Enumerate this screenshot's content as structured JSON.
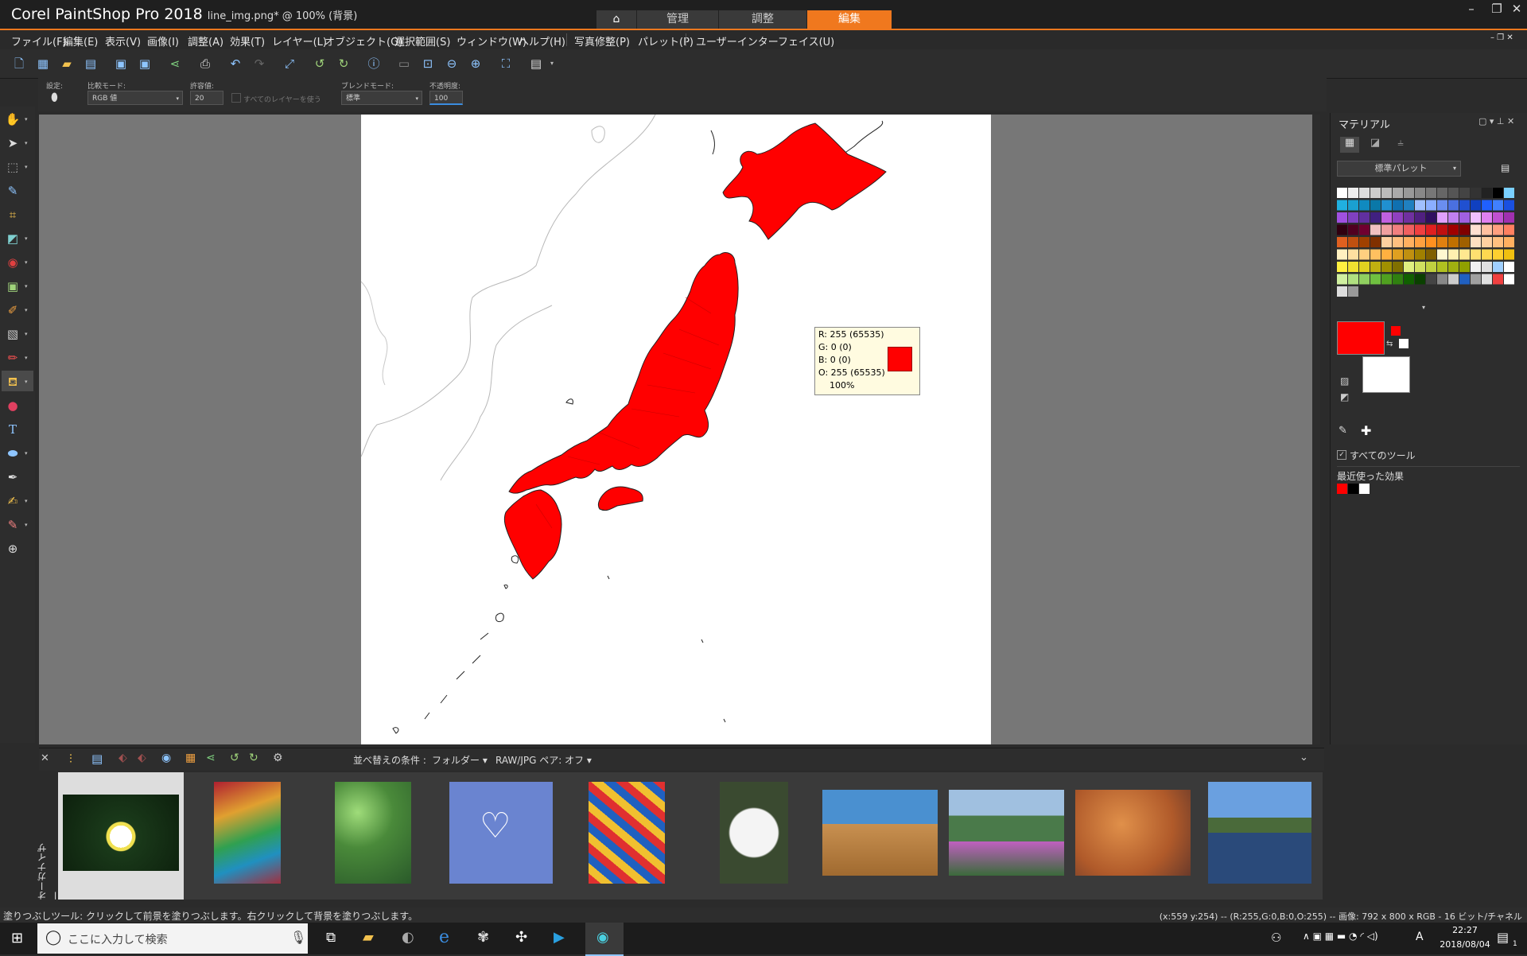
{
  "titlebar": {
    "app_name": "Corel PaintShop Pro 2018",
    "document": "line_img.png* @ 100% (背景)",
    "tabs": [
      "管理",
      "調整",
      "編集"
    ],
    "active_tab": "編集"
  },
  "menu": [
    "ファイル(F)",
    "編集(E)",
    "表示(V)",
    "画像(I)",
    "調整(A)",
    "効果(T)",
    "レイヤー(L)",
    "オブジェクト(O)",
    "選択範囲(S)",
    "ウィンドウ(W)",
    "ヘルプ(H)",
    "写真修整(P)",
    "パレット(P)",
    "ユーザーインターフェイス(U)"
  ],
  "options": {
    "preset_label": "設定:",
    "match_mode_label": "比較モード:",
    "match_mode_value": "RGB 値",
    "tolerance_label": "許容値:",
    "tolerance_value": "20",
    "all_layers_label": "すべてのレイヤーを使う",
    "blend_mode_label": "ブレンドモード:",
    "blend_mode_value": "標準",
    "opacity_label": "不透明度:",
    "opacity_value": "100"
  },
  "colortip": {
    "r": "R: 255  (65535)",
    "g": "G: 0  (0)",
    "b": "B: 0  (0)",
    "o": "O: 255  (65535)",
    "pct": "100%"
  },
  "materials": {
    "title": "マテリアル",
    "palette_select": "標準パレット",
    "all_tools_label": "すべてのツール",
    "recent_label": "最近使った効果",
    "fg_color": "#ff0000",
    "bg_color": "#ffffff",
    "recent_colors": [
      "#ff0000",
      "#000000",
      "#ffffff"
    ]
  },
  "organizer": {
    "title": "オーガナイザー",
    "sort_label": "並べ替えの条件 :",
    "sort_value": "フォルダー",
    "raw_jpg": "RAW/JPG ペア: オフ"
  },
  "status": {
    "hint": "塗りつぶしツール: クリックして前景を塗りつぶします。右クリックして背景を塗りつぶします。",
    "info": "(x:559 y:254) -- (R:255,G:0,B:0,O:255) -- 画像:  792 x 800 x RGB - 16 ビット/チャネル"
  },
  "taskbar": {
    "search_placeholder": "ここに入力して検索",
    "time": "22:27",
    "date": "2018/08/04",
    "ime": "A",
    "notify_count": "1"
  }
}
